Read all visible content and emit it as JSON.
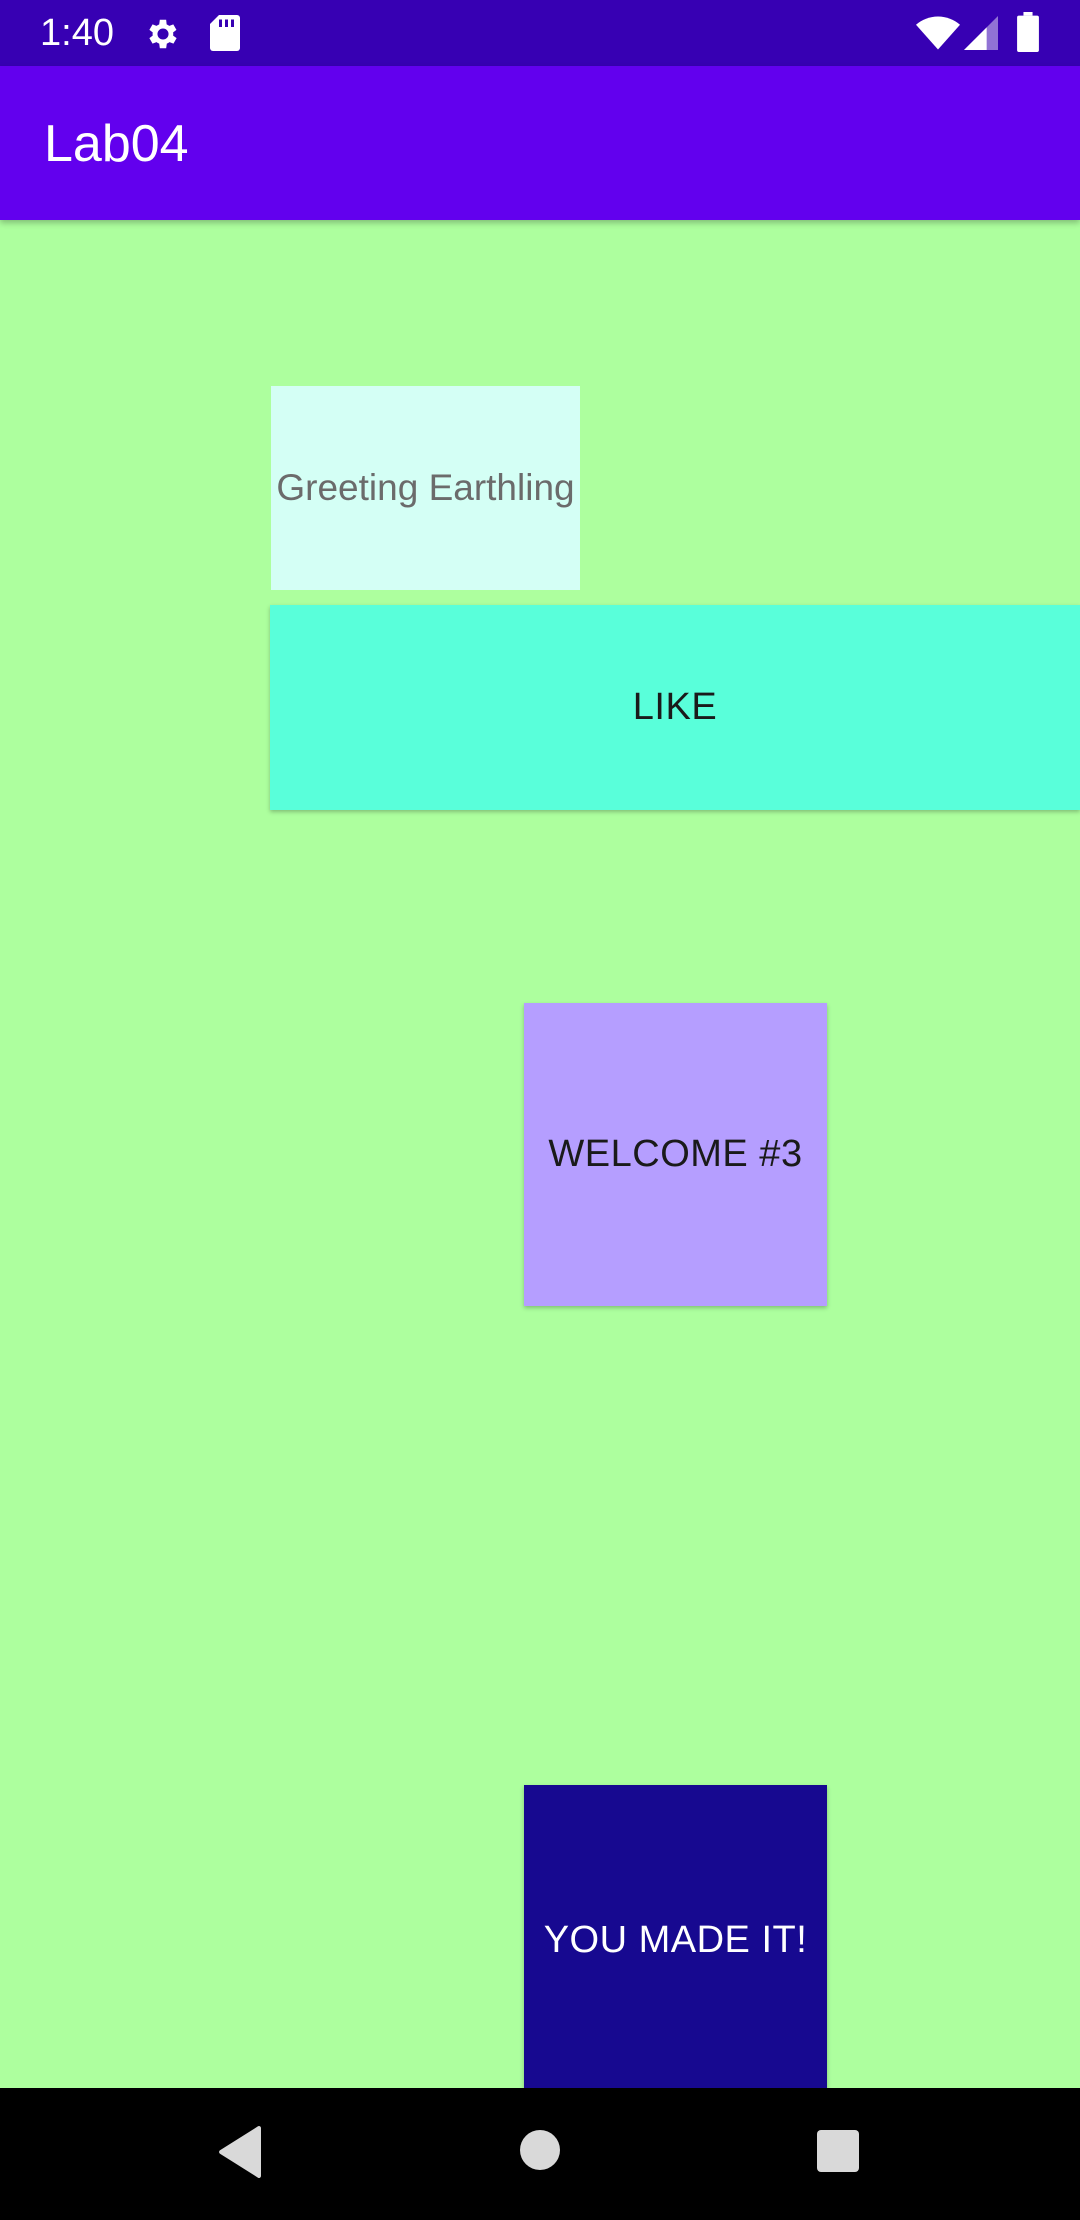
{
  "status_bar": {
    "time": "1:40",
    "icons": [
      "gear-icon",
      "sd-card-icon",
      "wifi-icon",
      "signal-icon",
      "battery-icon"
    ]
  },
  "app_bar": {
    "title": "Lab04"
  },
  "main": {
    "greeting_text": "Greeting Earthling",
    "like_button_label": "LIKE",
    "welcome_button_label": "WELCOME #3",
    "made_it_button_label": "YOU MADE IT!"
  },
  "nav_bar": {
    "icons": [
      "back-icon",
      "home-icon",
      "recents-icon"
    ]
  },
  "colors": {
    "status_bar": "#3700b3",
    "app_bar": "#6200ee",
    "background": "#adff9e",
    "greeting_box": "#d4fff5",
    "like_button": "#59ffda",
    "welcome_button": "#b59eff",
    "made_it_button": "#170990"
  }
}
